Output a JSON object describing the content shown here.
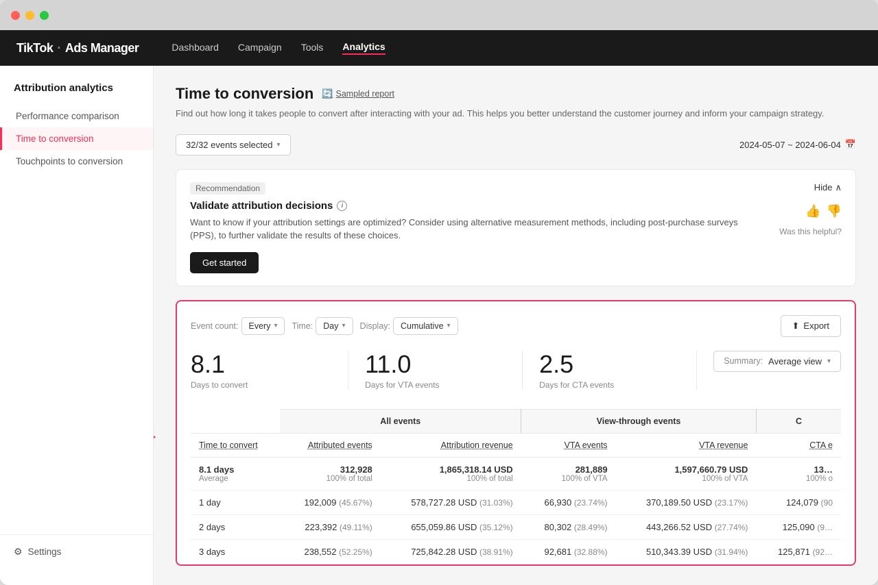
{
  "window": {
    "title": "TikTok Ads Manager"
  },
  "topnav": {
    "logo": "TikTok",
    "logo_dot": "·",
    "ads_manager": "Ads Manager",
    "links": [
      "Dashboard",
      "Campaign",
      "Tools",
      "Analytics"
    ],
    "active_link": "Analytics"
  },
  "sidebar": {
    "section_title": "Attribution analytics",
    "items": [
      {
        "label": "Performance comparison",
        "active": false
      },
      {
        "label": "Time to conversion",
        "active": true
      },
      {
        "label": "Touchpoints to conversion",
        "active": false
      }
    ],
    "settings_label": "Settings"
  },
  "page": {
    "title": "Time to conversion",
    "sampled_report": "Sampled report",
    "subtitle": "Find out how long it takes people to convert after interacting with your ad. This helps you better understand the customer journey and inform your campaign strategy.",
    "events_dropdown": "32/32 events selected",
    "date_range": "2024-05-07 ~ 2024-06-04"
  },
  "recommendation": {
    "tag": "Recommendation",
    "hide_label": "Hide",
    "title": "Validate attribution decisions",
    "body": "Want to know if your attribution settings are optimized? Consider using alternative measurement methods, including post-purchase surveys (PPS), to further validate the results of these choices.",
    "cta": "Get started",
    "was_helpful": "Was this helpful?"
  },
  "data_card": {
    "event_count_label": "Event count:",
    "event_count_value": "Every",
    "time_label": "Time:",
    "time_value": "Day",
    "display_label": "Display:",
    "display_value": "Cumulative",
    "export_label": "Export",
    "summary_label": "Summary:",
    "summary_value": "Average view",
    "stats": [
      {
        "value": "8.1",
        "label": "Days to convert"
      },
      {
        "value": "11.0",
        "label": "Days for VTA events"
      },
      {
        "value": "2.5",
        "label": "Days for CTA events"
      }
    ],
    "table": {
      "col_groups": [
        {
          "label": "",
          "colspan": 1
        },
        {
          "label": "All events",
          "colspan": 2
        },
        {
          "label": "View-through events",
          "colspan": 2
        },
        {
          "label": "C",
          "colspan": 1
        }
      ],
      "col_headers": [
        "Time to convert",
        "Attributed events",
        "Attribution revenue",
        "VTA events",
        "VTA revenue",
        "CTA e"
      ],
      "summary_row": {
        "time": "8.1 days",
        "time_sub": "Average",
        "events": "312,928",
        "events_sub": "100% of total",
        "revenue": "1,865,318.14 USD",
        "revenue_sub": "100% of total",
        "vta_events": "281,889",
        "vta_events_sub": "100% of VTA",
        "vta_revenue": "1,597,660.79 USD",
        "vta_revenue_sub": "100% of VTA",
        "cta_partial": "13…",
        "cta_sub": "100% o"
      },
      "rows": [
        {
          "time": "1 day",
          "events": "192,009",
          "events_pct": "(45.67%)",
          "revenue": "578,727.28 USD",
          "revenue_pct": "(31.03%)",
          "vta_events": "66,930",
          "vta_events_pct": "(23.74%)",
          "vta_revenue": "370,189.50 USD",
          "vta_revenue_pct": "(23.17%)",
          "cta_partial": "124,079",
          "cta_pct": "(90"
        },
        {
          "time": "2 days",
          "events": "223,392",
          "events_pct": "(49.11%)",
          "revenue": "655,059.86 USD",
          "revenue_pct": "(35.12%)",
          "vta_events": "80,302",
          "vta_events_pct": "(28.49%)",
          "vta_revenue": "443,266.52 USD",
          "vta_revenue_pct": "(27.74%)",
          "cta_partial": "125,090",
          "cta_pct": "(9…"
        },
        {
          "time": "3 days",
          "events": "238,552",
          "events_pct": "(52.25%)",
          "revenue": "725,842.28 USD",
          "revenue_pct": "(38.91%)",
          "vta_events": "92,681",
          "vta_events_pct": "(32.88%)",
          "vta_revenue": "510,343.39 USD",
          "vta_revenue_pct": "(31.94%)",
          "cta_partial": "125,871",
          "cta_pct": "(92…"
        }
      ]
    }
  },
  "arrow": {
    "symbol": "→"
  }
}
